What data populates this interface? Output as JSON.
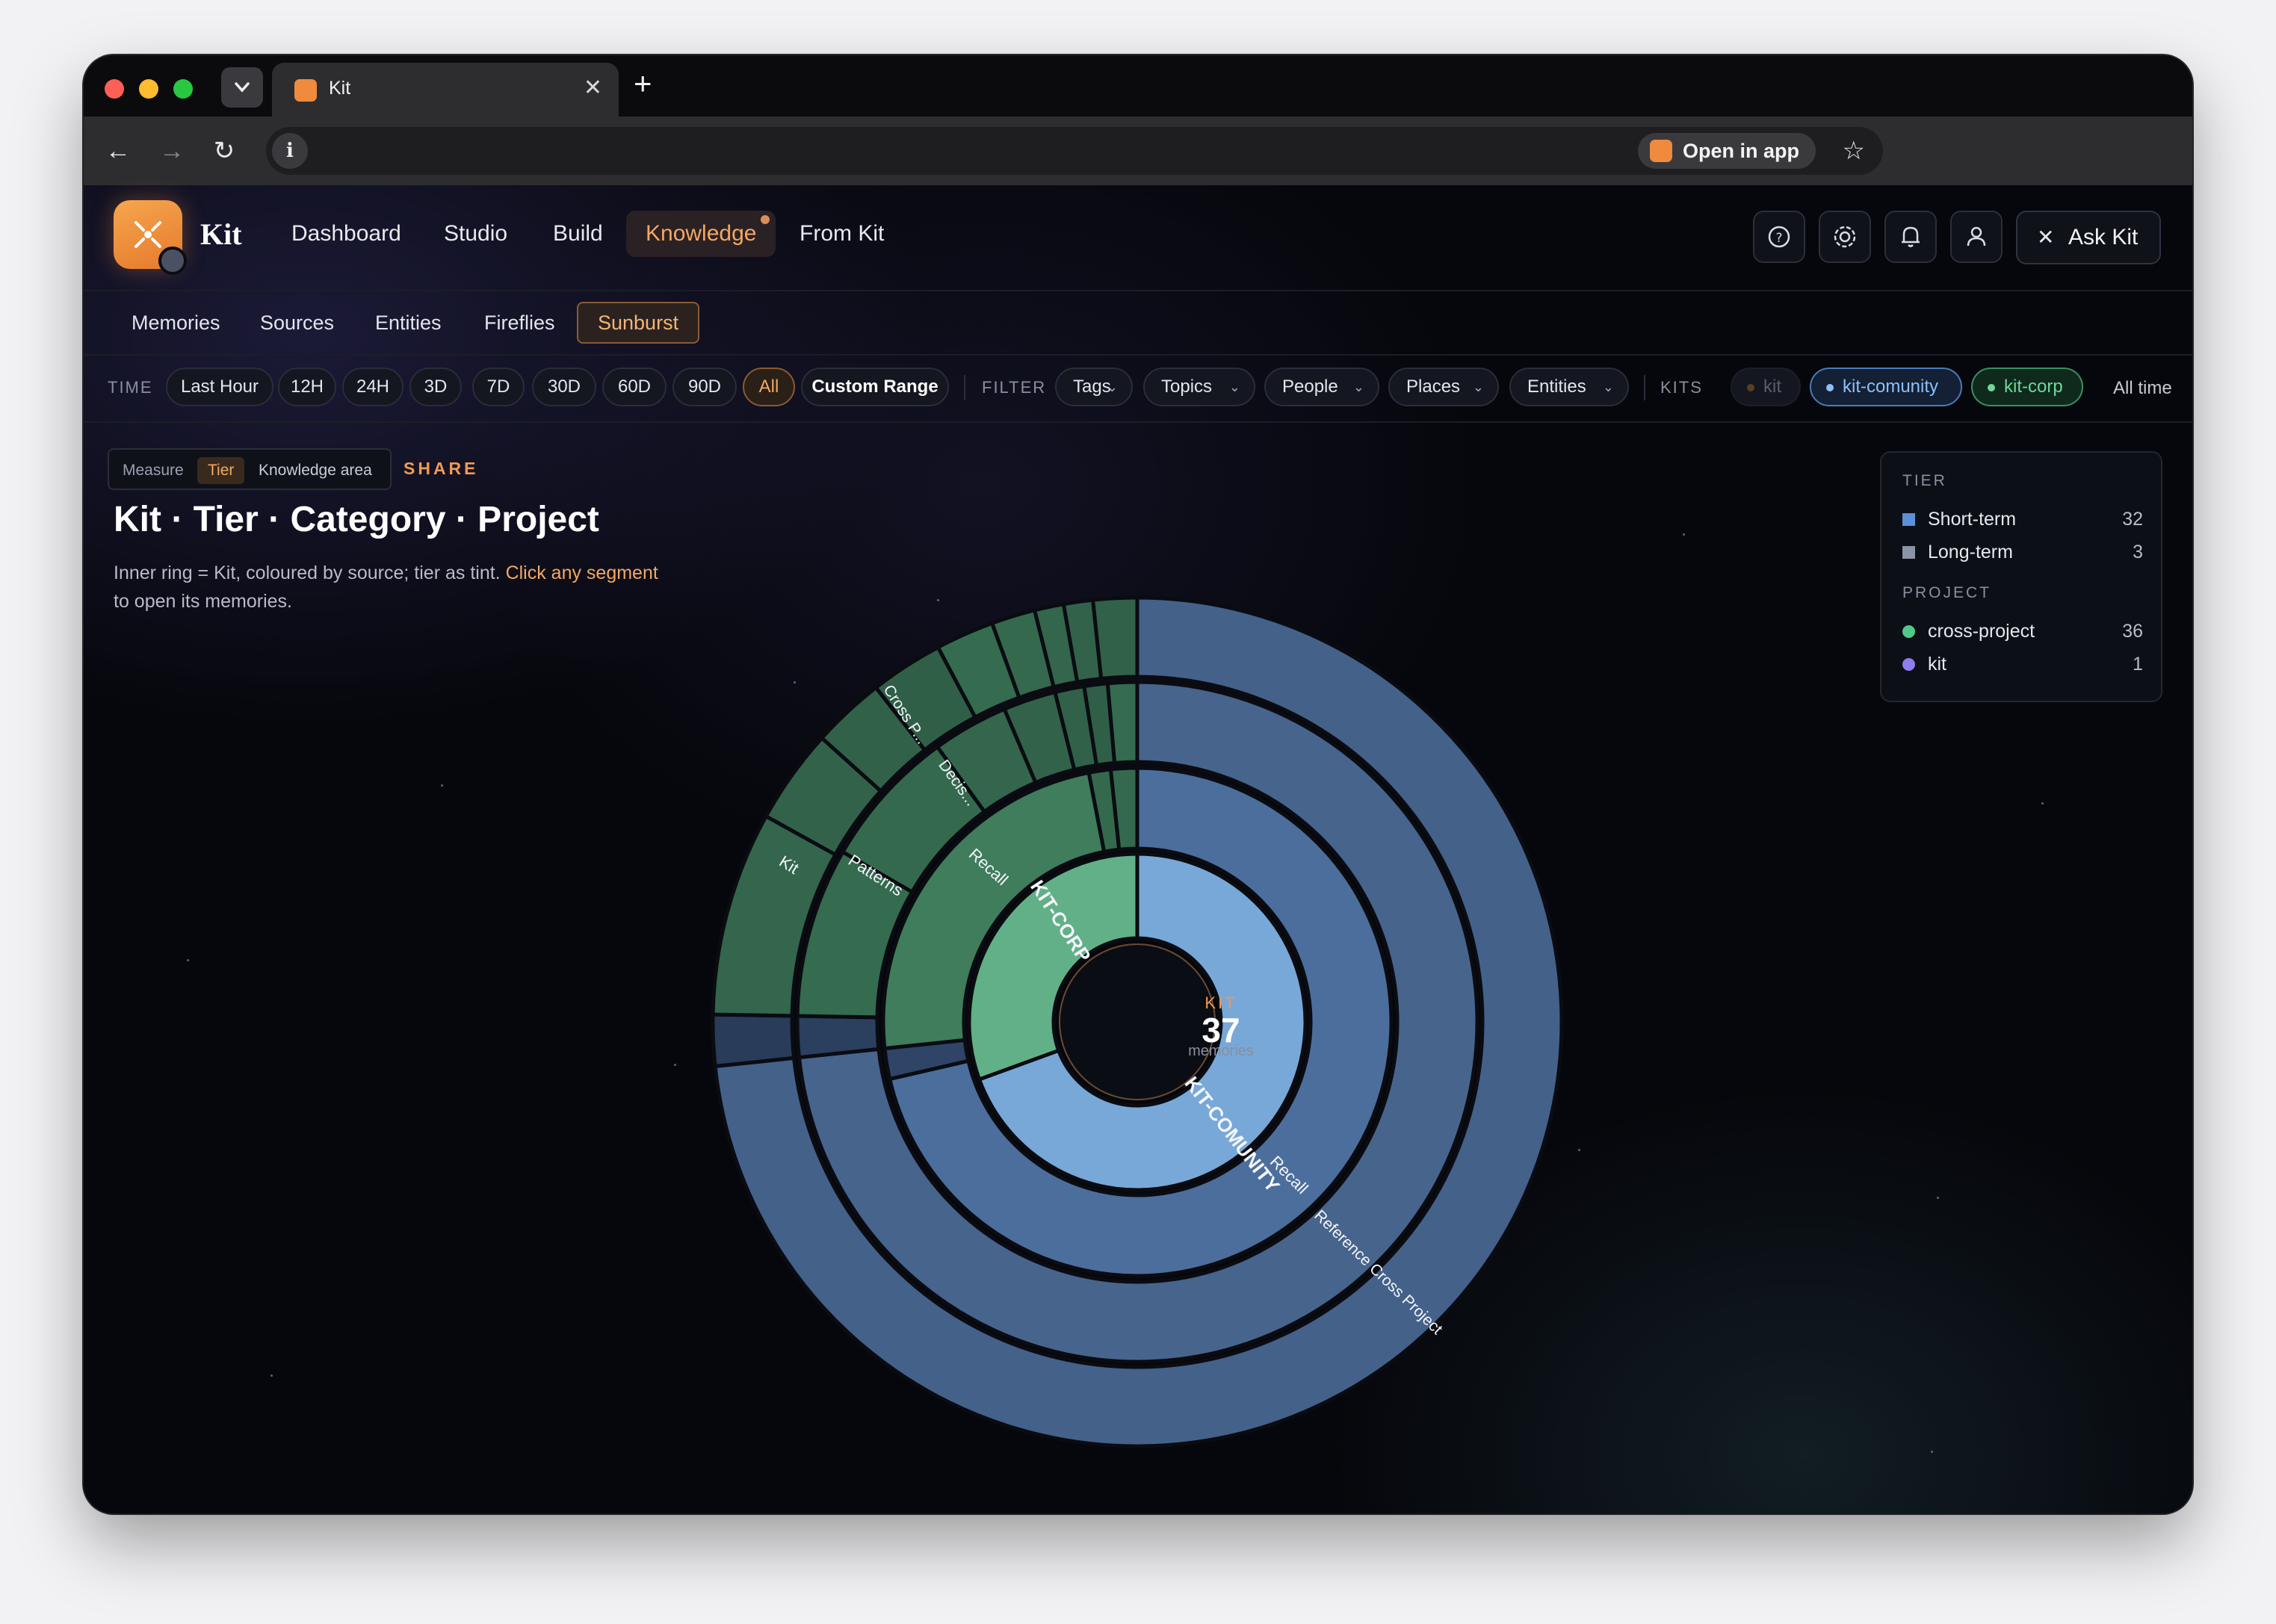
{
  "browser": {
    "tab_title": "Kit",
    "tab_close": "✕",
    "new_tab": "+",
    "open_in_app": "Open in app",
    "info_glyph": "i",
    "star_glyph": "☆",
    "back_glyph": "←",
    "forward_glyph": "→",
    "reload_glyph": "↻",
    "dropdown_glyph": "⌄"
  },
  "app": {
    "brand": "Kit",
    "nav": [
      "Dashboard",
      "Studio",
      "Build",
      "Knowledge",
      "From Kit"
    ],
    "active_nav": "Knowledge",
    "ask_label": "Ask Kit",
    "icons": {
      "help": "?",
      "settings": "⚙",
      "bell": "🔔",
      "user": "👤",
      "ask": "✕",
      "logo": "✕"
    },
    "subtabs": [
      "Memories",
      "Sources",
      "Entities",
      "Fireflies",
      "Sunburst"
    ],
    "active_subtab": "Sunburst"
  },
  "filters": {
    "time_label": "TIME",
    "time_options": [
      "Last Hour",
      "12H",
      "24H",
      "3D",
      "7D",
      "30D",
      "60D",
      "90D",
      "All"
    ],
    "active_time": "All",
    "custom_range": "Custom Range",
    "filter_label": "FILTER",
    "dropdowns": [
      "Tags",
      "Topics",
      "People",
      "Places",
      "Entities"
    ],
    "chevron": "⌄",
    "kits_label": "KITS",
    "kits": [
      "kit",
      "kit-comunity",
      "kit-corp"
    ],
    "range_text": "All time"
  },
  "view": {
    "measure_label": "Measure",
    "tier_label": "Tier",
    "knowledge_area_label": "Knowledge area",
    "share_label": "SHARE",
    "title": "Kit · Tier · Category · Project",
    "description_plain": "Inner ring = Kit, coloured by source; tier as tint. ",
    "description_link": "Click any segment",
    "description_tail": "to open its memories."
  },
  "legend": {
    "tier_heading": "TIER",
    "tiers": [
      {
        "label": "Short-term",
        "count": "32",
        "color": "#5b8fd6"
      },
      {
        "label": "Long-term",
        "count": "3",
        "color": "#8b93a6"
      }
    ],
    "project_heading": "PROJECT",
    "projects": [
      {
        "label": "cross-project",
        "count": "36",
        "color": "#4fc98a"
      },
      {
        "label": "kit",
        "count": "1",
        "color": "#8e7cf0"
      }
    ]
  },
  "sunburst": {
    "center_top": "KIT",
    "center_count": "37",
    "center_bottom": "memories",
    "labels": [
      "KIT-CORP",
      "Recall",
      "Patterns",
      "Kit",
      "Decis...",
      "Cross P...",
      "KIT-COMUNITY",
      "Recall",
      "Reference Cross Project"
    ]
  }
}
